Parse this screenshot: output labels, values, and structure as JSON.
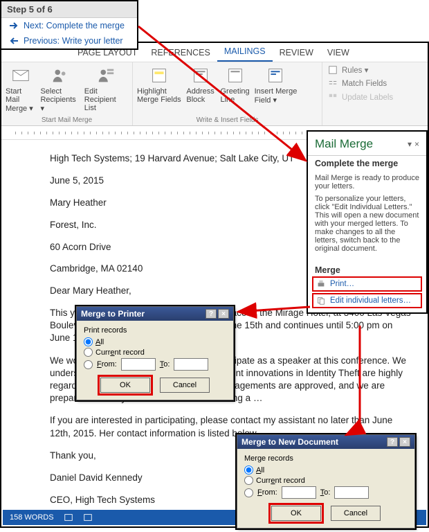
{
  "step_box": {
    "title": "Step 5 of 6",
    "next": "Next: Complete the merge",
    "prev": "Previous: Write your letter"
  },
  "tabs": {
    "page_layout": "PAGE LAYOUT",
    "references": "REFERENCES",
    "mailings": "MAILINGS",
    "review": "REVIEW",
    "view": "VIEW"
  },
  "ribbon": {
    "start_mail_merge": "Start Mail\nMerge ▾",
    "select_recipients": "Select\nRecipients ▾",
    "edit_recipient_list": "Edit\nRecipient List",
    "group_start": "Start Mail Merge",
    "highlight_merge_fields": "Highlight\nMerge Fields",
    "address_block": "Address\nBlock",
    "greeting_line": "Greeting\nLine",
    "insert_merge_field": "Insert Merge\nField ▾",
    "group_write": "Write & Insert Fields",
    "rules": "Rules ▾",
    "match_fields": "Match Fields",
    "update_labels": "Update Labels"
  },
  "doc": {
    "header": "High Tech Systems; 19 Harvard Avenue; Salt Lake City, UT",
    "date": "June 5, 2015",
    "addr_name": "Mary Heather",
    "addr_company": "Forest, Inc.",
    "addr_street": "60 Acorn Drive",
    "addr_citystate": "Cambridge, MA 02140",
    "greeting": "Dear Mary Heather,",
    "p1": "This year, our annual conference will take place at the Mirage Hotel, at 3400 Las Vegas Boulevard South. It begins at 1:00 pm on June 15th and continues until 5:00 pm on June 19th, 2015.",
    "p2": "We would be very pleased if you could participate as a speaker at this conference. We understand that your expertise and your recent innovations in Identity Theft are highly regarded. Your regular fees for speaking engagements are approved, and we are prepared to offer you a 10% increase including a …",
    "p3": "If you are interested in participating, please contact my assistant no later than June 12th, 2015. Her contact information is listed below.",
    "thanks": "Thank you,",
    "sig_name": "Daniel David Kennedy",
    "sig_title": "CEO, High Tech Systems"
  },
  "mm_pane": {
    "title": "Mail Merge",
    "subtitle": "Complete the merge",
    "body1": "Mail Merge is ready to produce your letters.",
    "body2": "To personalize your letters, click \"Edit Individual Letters.\" This will open a new document with your merged letters. To make changes to all the letters, switch back to the original document.",
    "merge_label": "Merge",
    "print": "Print…",
    "edit": "Edit individual letters…"
  },
  "dlg_print": {
    "title": "Merge to Printer",
    "fieldset": "Print records",
    "opt_all": "All",
    "opt_current": "Current record",
    "opt_from": "From:",
    "to": "To:",
    "ok": "OK",
    "cancel": "Cancel"
  },
  "dlg_new": {
    "title": "Merge to New Document",
    "fieldset": "Merge records",
    "opt_all": "All",
    "opt_current": "Current record",
    "opt_from": "From:",
    "to": "To:",
    "ok": "OK",
    "cancel": "Cancel"
  },
  "status": {
    "words": "158 WORDS"
  }
}
